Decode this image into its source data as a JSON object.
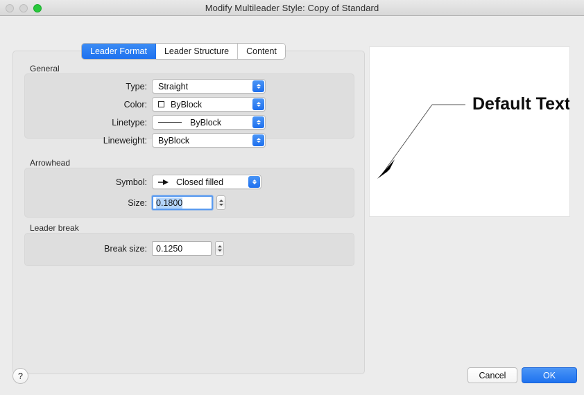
{
  "window": {
    "title": "Modify Multileader Style: Copy of Standard",
    "traffic_lights": [
      "close-button",
      "minimize-button",
      "zoom-button"
    ],
    "accent_color": "#1f72ef",
    "zoom_light_color": "#28c83c"
  },
  "tabs": [
    {
      "label": "Leader Format",
      "active": true
    },
    {
      "label": "Leader Structure",
      "active": false
    },
    {
      "label": "Content",
      "active": false
    }
  ],
  "groups": {
    "general": {
      "label": "General",
      "rows": [
        {
          "label": "Type:",
          "value": "Straight",
          "control": "popup",
          "ornament": "none"
        },
        {
          "label": "Color:",
          "value": "ByBlock",
          "control": "popup",
          "ornament": "color-swatch"
        },
        {
          "label": "Linetype:",
          "value": "ByBlock",
          "control": "popup",
          "ornament": "line-sample"
        },
        {
          "label": "Lineweight:",
          "value": "ByBlock",
          "control": "popup",
          "ornament": "none"
        }
      ]
    },
    "arrowhead": {
      "label": "Arrowhead",
      "symbol_label": "Symbol:",
      "symbol_value": "Closed filled",
      "size_label": "Size:",
      "size_value": "0.1800",
      "size_focused": true
    },
    "leader_break": {
      "label": "Leader break",
      "break_size_label": "Break size:",
      "break_size_value": "0.1250"
    }
  },
  "preview": {
    "text": "Default Text",
    "line_color": "#555555",
    "arrow_color": "#000000",
    "background": "#ffffff"
  },
  "footer": {
    "help_label": "?",
    "cancel_label": "Cancel",
    "ok_label": "OK"
  }
}
